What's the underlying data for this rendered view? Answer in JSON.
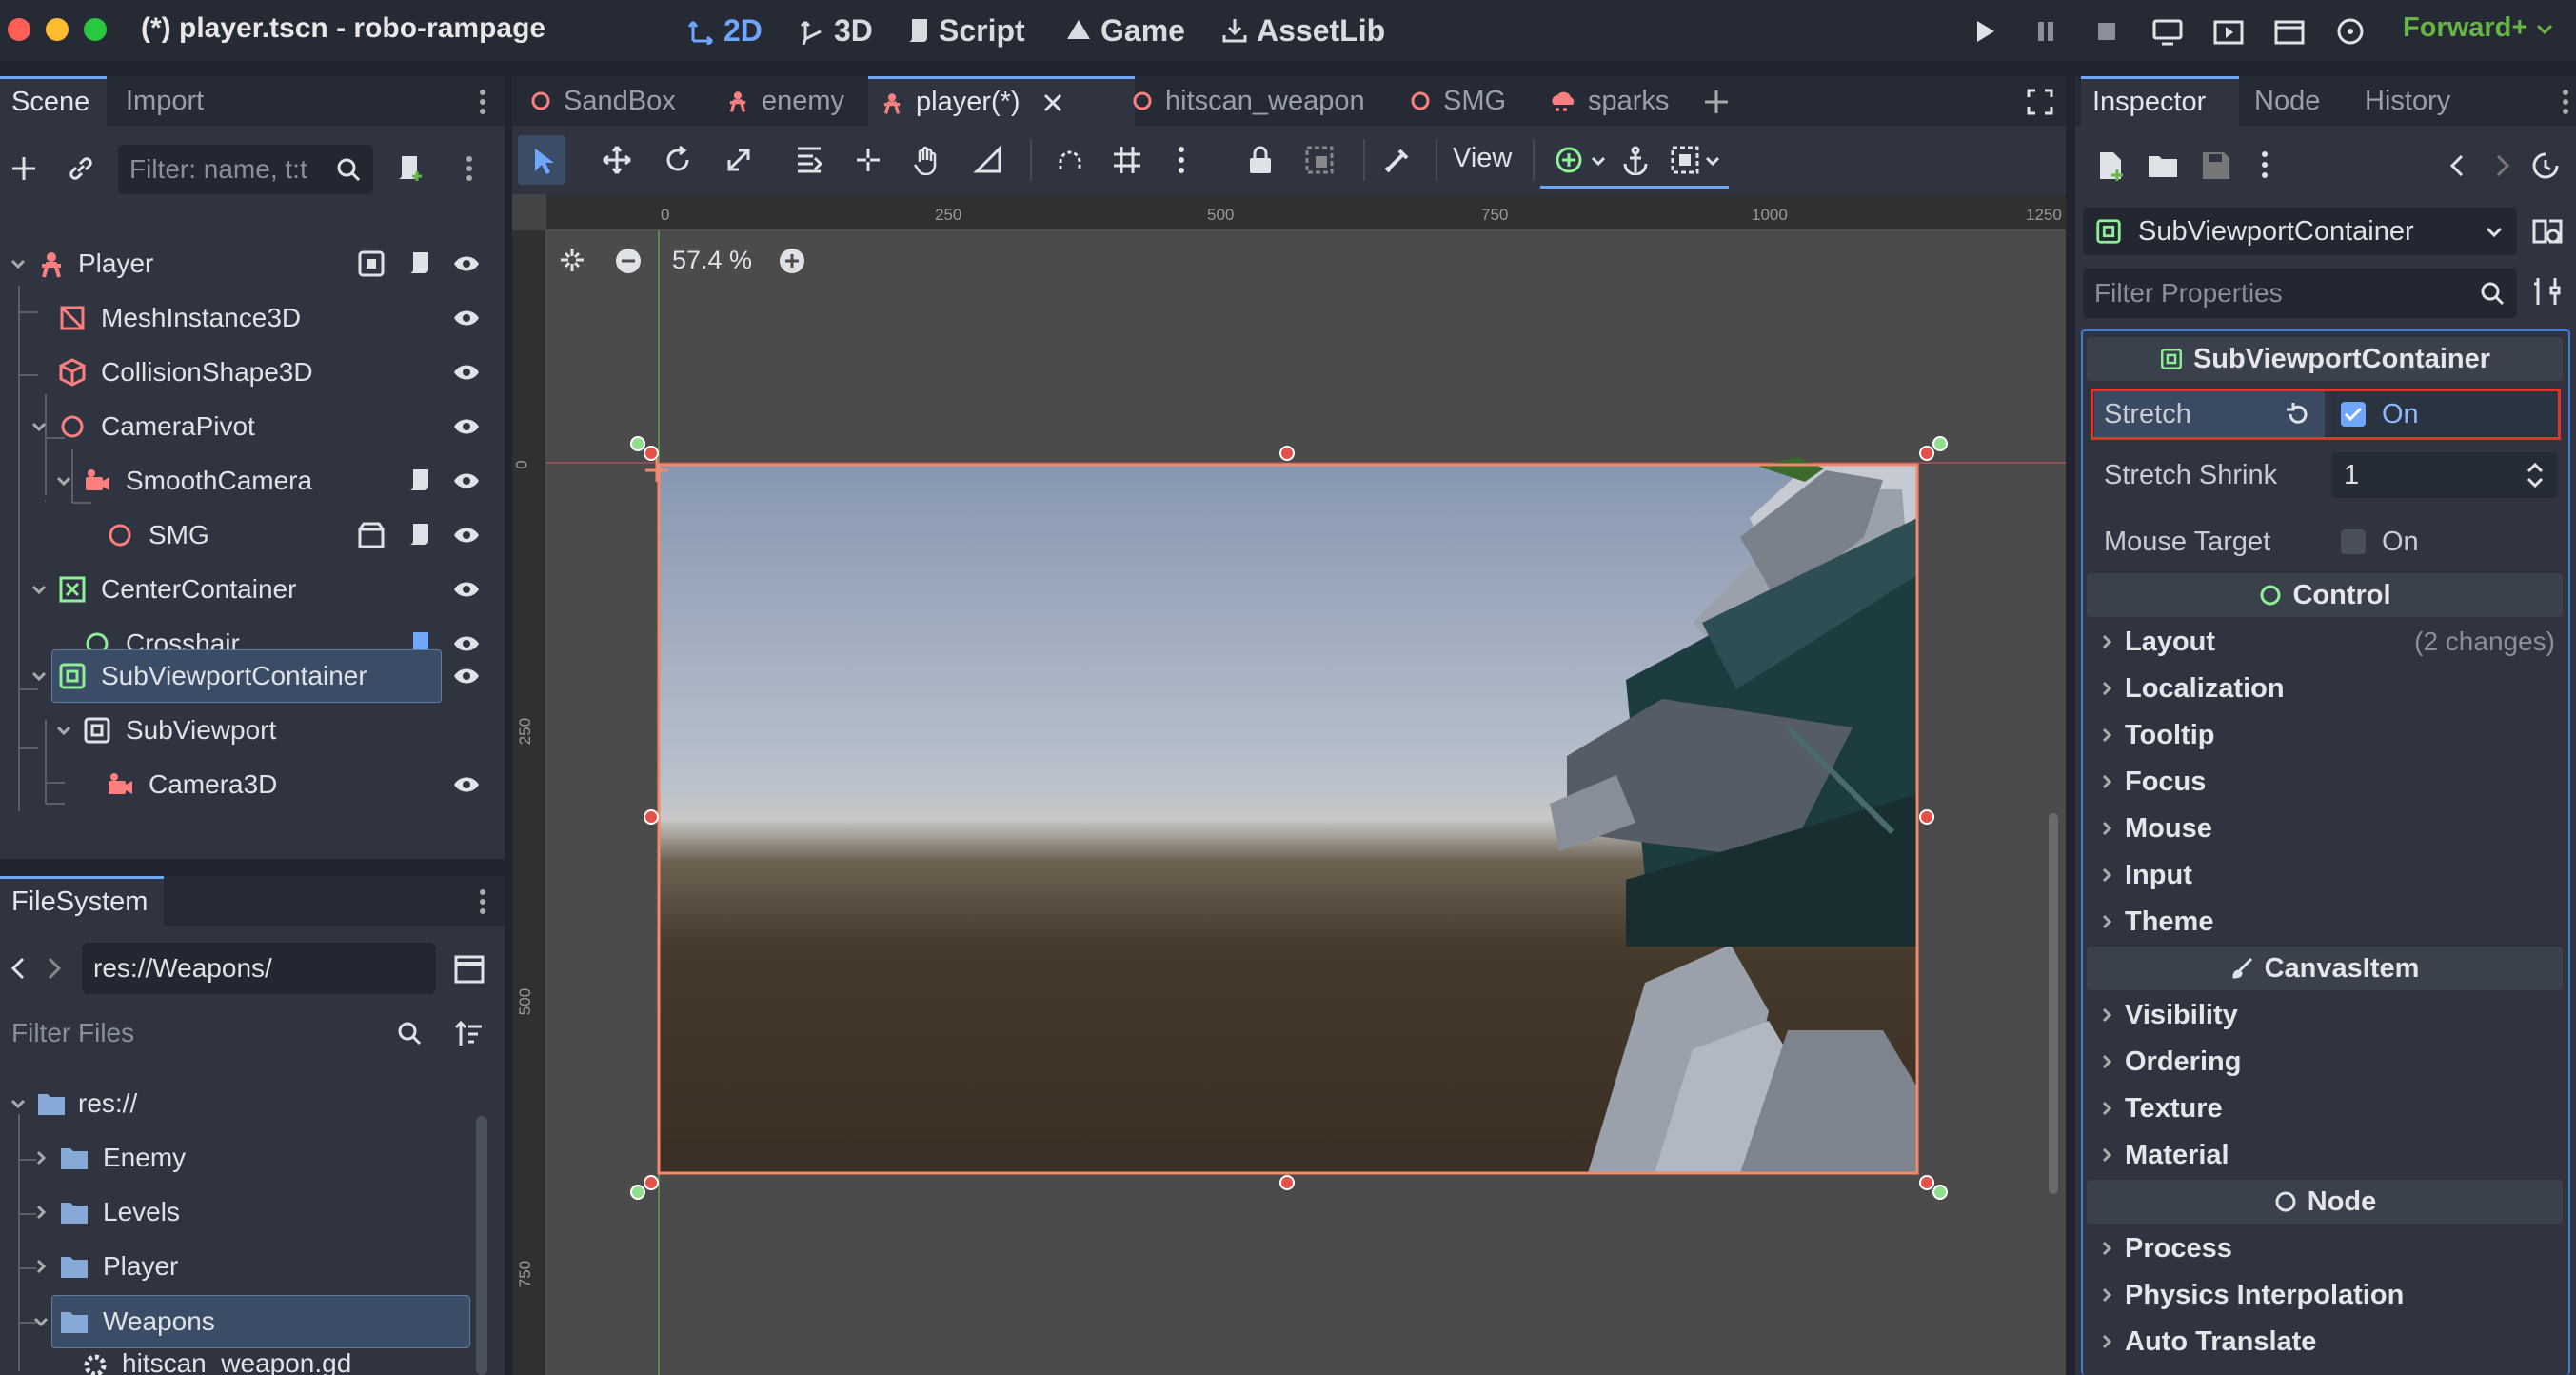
{
  "window": {
    "title": "(*) player.tscn - robo-rampage",
    "renderer": "Forward+"
  },
  "modes": [
    {
      "label": "2D",
      "active": true
    },
    {
      "label": "3D",
      "active": false
    },
    {
      "label": "Script",
      "active": false
    },
    {
      "label": "Game",
      "active": false
    },
    {
      "label": "AssetLib",
      "active": false
    }
  ],
  "scene_dock": {
    "tabs": [
      "Scene",
      "Import"
    ],
    "filter_placeholder": "Filter: name, t:t",
    "tree": [
      {
        "label": "Player"
      },
      {
        "label": "MeshInstance3D"
      },
      {
        "label": "CollisionShape3D"
      },
      {
        "label": "CameraPivot"
      },
      {
        "label": "SmoothCamera"
      },
      {
        "label": "SMG"
      },
      {
        "label": "CenterContainer"
      },
      {
        "label": "Crosshair"
      },
      {
        "label": "SubViewportContainer",
        "selected": true
      },
      {
        "label": "SubViewport"
      },
      {
        "label": "Camera3D"
      }
    ]
  },
  "filesystem": {
    "tab": "FileSystem",
    "path": "res://Weapons/",
    "filter_placeholder": "Filter Files",
    "items": [
      {
        "label": "res://"
      },
      {
        "label": "Enemy"
      },
      {
        "label": "Levels"
      },
      {
        "label": "Player"
      },
      {
        "label": "Weapons",
        "selected": true
      },
      {
        "label": "hitscan_weapon.gd"
      }
    ]
  },
  "editor_tabs": [
    {
      "label": "SandBox"
    },
    {
      "label": "enemy"
    },
    {
      "label": "player(*)",
      "active": true
    },
    {
      "label": "hitscan_weapon"
    },
    {
      "label": "SMG"
    },
    {
      "label": "sparks"
    }
  ],
  "toolbar": {
    "view_label": "View"
  },
  "canvas": {
    "zoom": "57.4 %",
    "ruler_top": [
      "0",
      "250",
      "500",
      "750",
      "1000",
      "1250"
    ],
    "ruler_left": [
      "0",
      "250",
      "500",
      "750"
    ]
  },
  "inspector": {
    "tabs": [
      "Inspector",
      "Node",
      "History"
    ],
    "node_selector": "SubViewportContainer",
    "filter_placeholder": "Filter Properties",
    "section_title": "SubViewportContainer",
    "properties": [
      {
        "name": "Stretch",
        "value": "On",
        "checked": true
      },
      {
        "name": "Stretch Shrink",
        "value": "1"
      },
      {
        "name": "Mouse Target",
        "value": "On",
        "checked": false
      }
    ],
    "control_title": "Control",
    "control_groups": [
      "Layout",
      "Localization",
      "Tooltip",
      "Focus",
      "Mouse",
      "Input",
      "Theme"
    ],
    "layout_changes": "(2 changes)",
    "canvasitem_title": "CanvasItem",
    "canvasitem_groups": [
      "Visibility",
      "Ordering",
      "Texture",
      "Material"
    ],
    "node_title": "Node",
    "node_groups": [
      "Process",
      "Physics Interpolation",
      "Auto Translate"
    ]
  },
  "colors": {
    "accent": "#6fa7ff",
    "selection": "#3b4d66",
    "highlight_red": "#e0342a",
    "renderer_green": "#68b444"
  }
}
